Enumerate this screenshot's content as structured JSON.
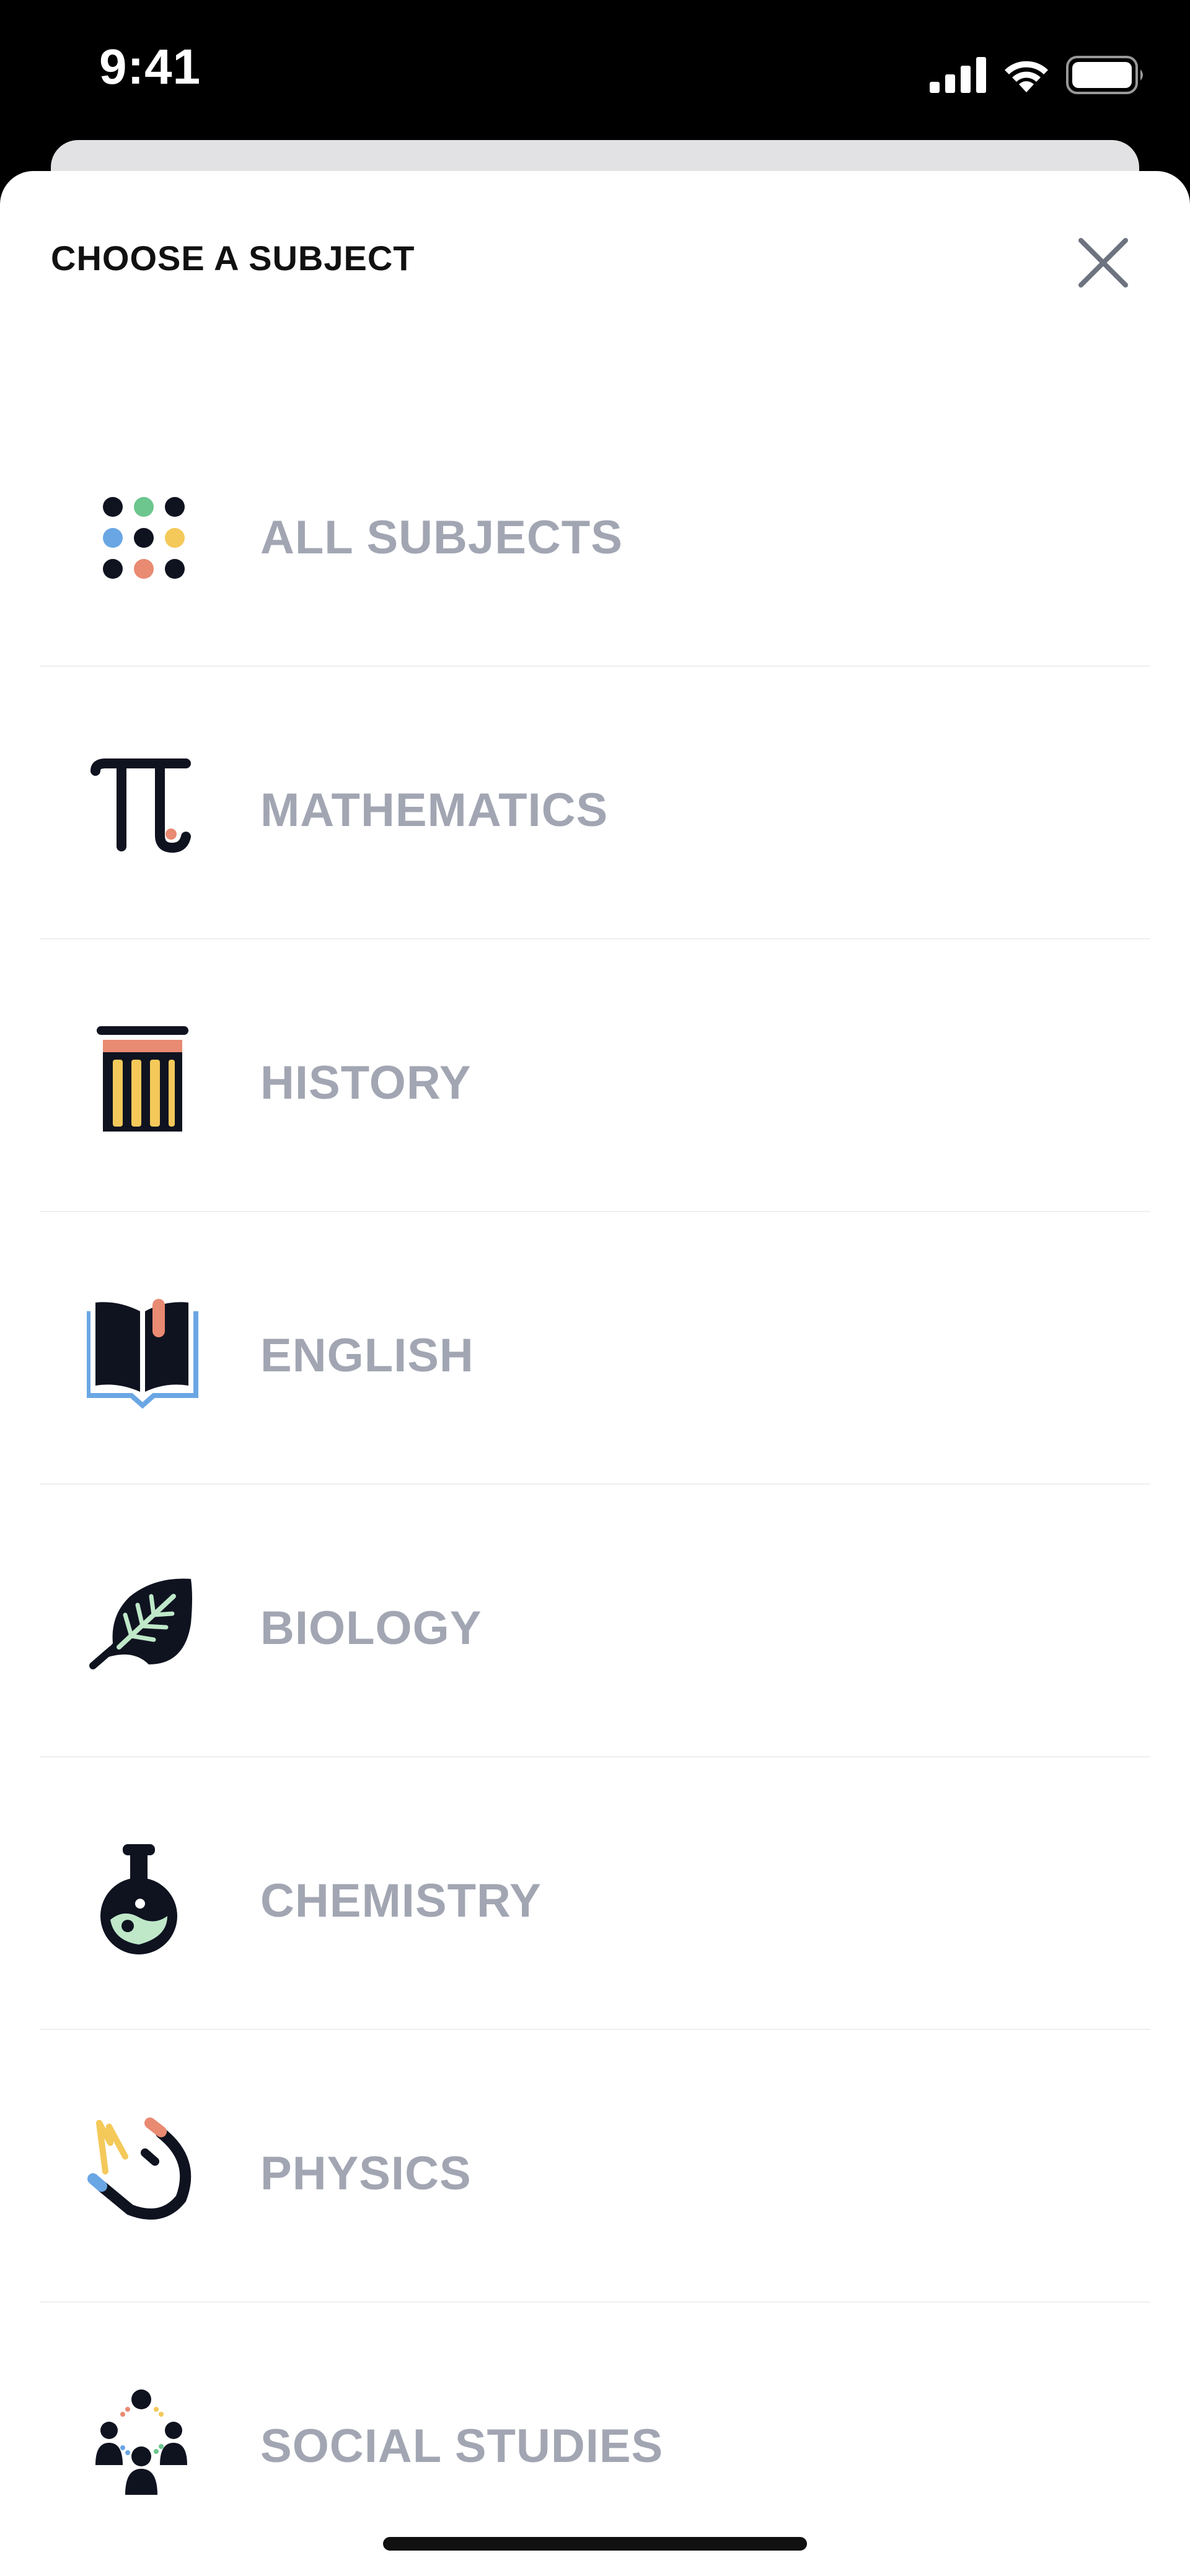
{
  "status_bar": {
    "time": "9:41"
  },
  "sheet": {
    "title": "CHOOSE A SUBJECT",
    "close_icon": "close-x-icon"
  },
  "subjects": [
    {
      "label": "ALL SUBJECTS",
      "icon": "dots-grid-icon"
    },
    {
      "label": "MATHEMATICS",
      "icon": "pi-icon"
    },
    {
      "label": "HISTORY",
      "icon": "column-icon"
    },
    {
      "label": "ENGLISH",
      "icon": "book-icon"
    },
    {
      "label": "BIOLOGY",
      "icon": "leaf-icon"
    },
    {
      "label": "CHEMISTRY",
      "icon": "flask-icon"
    },
    {
      "label": "PHYSICS",
      "icon": "magnet-icon"
    },
    {
      "label": "SOCIAL STUDIES",
      "icon": "people-icon"
    }
  ],
  "colors": {
    "label": "#a2a6b3",
    "dark": "#0f1320",
    "green": "#6cc68e",
    "blue": "#6aa6e4",
    "yellow": "#f4c95a",
    "salmon": "#e98a72",
    "mint": "#bfe8c9"
  }
}
